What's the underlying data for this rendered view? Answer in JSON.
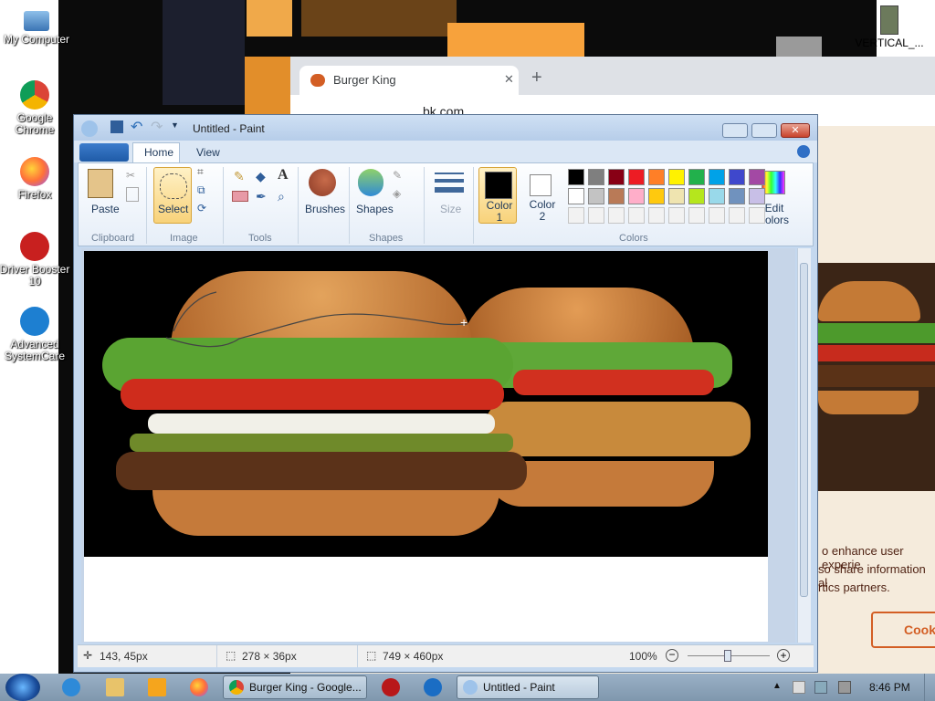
{
  "desktop": {
    "icons": [
      {
        "label": "My Computer"
      },
      {
        "label": "Google Chrome"
      },
      {
        "label": "Firefox"
      },
      {
        "label": "Driver Booster 10"
      },
      {
        "label": "Advanced SystemCare"
      },
      {
        "label": "VERTICAL_..."
      }
    ]
  },
  "browser": {
    "tab_title": "Burger King",
    "new_tab_symbol": "+",
    "close_symbol": "✕",
    "url": "bk.com",
    "page_text_lines": [
      "o enhance user experie",
      "so share information al",
      "rtics partners."
    ],
    "cookie_button": "Cook"
  },
  "paint": {
    "title": "Untitled - Paint",
    "tabs": [
      "Home",
      "View"
    ],
    "clipboard": {
      "paste": "Paste",
      "group": "Clipboard"
    },
    "image": {
      "select": "Select",
      "group": "Image"
    },
    "tools": {
      "group": "Tools"
    },
    "brushes": "Brushes",
    "shapes": {
      "label": "Shapes",
      "group": "Shapes"
    },
    "size": "Size",
    "color1": "Color 1",
    "color2": "Color 2",
    "colors_group": "Colors",
    "edit_colors": "Edit colors",
    "palette_row1": [
      "#000000",
      "#7f7f7f",
      "#880015",
      "#ed1c24",
      "#ff7f27",
      "#fff200",
      "#22b14c",
      "#00a2e8",
      "#3f48cc",
      "#a349a4"
    ],
    "palette_row2": [
      "#ffffff",
      "#c3c3c3",
      "#b97a57",
      "#ffaec9",
      "#ffc90e",
      "#efe4b0",
      "#b5e61d",
      "#99d9ea",
      "#7092be",
      "#c8bfe7"
    ],
    "status": {
      "cursor_pos": "143, 45px",
      "selection_size": "278 × 36px",
      "image_size": "749 × 460px",
      "zoom": "100%"
    }
  },
  "taskbar": {
    "chrome_task": "Burger King - Google...",
    "paint_task": "Untitled - Paint",
    "clock": "8:46 PM"
  },
  "colors": {
    "bk_orange": "#d35e24",
    "paint_accent": "#f8d27a",
    "taskbar": "#8ea5bb"
  }
}
